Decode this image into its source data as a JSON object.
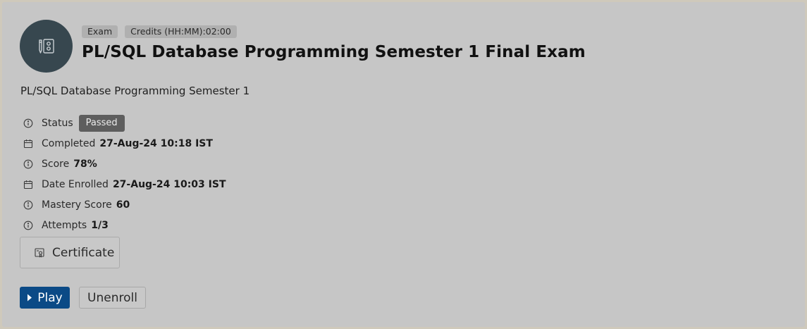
{
  "course": {
    "icon": "exam-document-icon",
    "badges": [
      "Exam",
      "Credits (HH:MM):02:00"
    ],
    "title": "PL/SQL Database Programming Semester 1 Final Exam",
    "subtitle": "PL/SQL Database Programming Semester 1"
  },
  "details": {
    "status": {
      "label": "Status",
      "value": "Passed",
      "icon": "info-icon"
    },
    "completed": {
      "label": "Completed",
      "value": "27-Aug-24 10:18 IST",
      "icon": "calendar-icon"
    },
    "score": {
      "label": "Score",
      "value": "78%",
      "icon": "info-icon"
    },
    "date_enrolled": {
      "label": "Date Enrolled",
      "value": "27-Aug-24 10:03 IST",
      "icon": "calendar-icon"
    },
    "mastery_score": {
      "label": "Mastery Score",
      "value": "60",
      "icon": "info-icon"
    },
    "attempts": {
      "label": "Attempts",
      "value": "1/3",
      "icon": "info-icon"
    }
  },
  "actions": {
    "certificate_label": "Certificate",
    "play_label": "Play",
    "unenroll_label": "Unenroll"
  },
  "colors": {
    "card_background": "#c6c6c6",
    "avatar_background": "#37474f",
    "status_pill": "#5e5e5e",
    "primary_button": "#0b4a86"
  }
}
